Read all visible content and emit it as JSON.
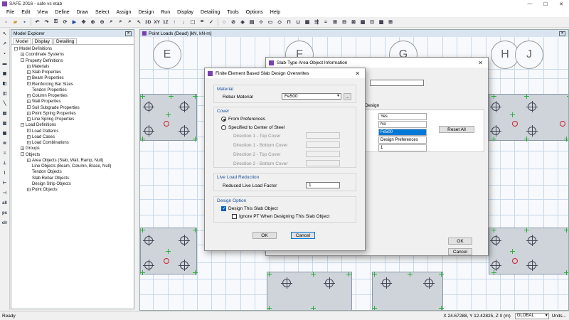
{
  "window": {
    "title": "SAFE 2016 - safe vs etab",
    "controls": [
      "—",
      "☐",
      "✕"
    ]
  },
  "menu": [
    "File",
    "Edit",
    "View",
    "Define",
    "Draw",
    "Select",
    "Assign",
    "Design",
    "Run",
    "Display",
    "Detailing",
    "Tools",
    "Options",
    "Help"
  ],
  "toolbar": {
    "btn_3d": "3D",
    "btn_xy": "XY",
    "btn_1z": "1Z"
  },
  "left_tools": [
    "all",
    "ps",
    "clr"
  ],
  "explorer": {
    "title": "Model Explorer",
    "tabs": [
      "Model",
      "Display",
      "Detailing"
    ],
    "tree": [
      {
        "label": "Model Definitions",
        "level": 0,
        "expander": "-"
      },
      {
        "label": "Coordinate Systems",
        "level": 1,
        "expander": "+"
      },
      {
        "label": "Property Definitions",
        "level": 1,
        "expander": "-"
      },
      {
        "label": "Materials",
        "level": 2,
        "expander": "+"
      },
      {
        "label": "Slab Properties",
        "level": 2,
        "expander": "+"
      },
      {
        "label": "Beam Properties",
        "level": 2,
        "expander": "+"
      },
      {
        "label": "Reinforcing Bar Sizes",
        "level": 2,
        "expander": "+"
      },
      {
        "label": "Tendon Properties",
        "level": 2,
        "expander": ""
      },
      {
        "label": "Column Properties",
        "level": 2,
        "expander": "+"
      },
      {
        "label": "Wall Properties",
        "level": 2,
        "expander": "+"
      },
      {
        "label": "Soil Subgrade Properties",
        "level": 2,
        "expander": "+"
      },
      {
        "label": "Point Spring Properties",
        "level": 2,
        "expander": "+"
      },
      {
        "label": "Line Spring Properties",
        "level": 2,
        "expander": "+"
      },
      {
        "label": "Load Definitions",
        "level": 1,
        "expander": "-"
      },
      {
        "label": "Load Patterns",
        "level": 2,
        "expander": "+"
      },
      {
        "label": "Load Cases",
        "level": 2,
        "expander": "+"
      },
      {
        "label": "Load Combinations",
        "level": 2,
        "expander": "+"
      },
      {
        "label": "Groups",
        "level": 1,
        "expander": "+"
      },
      {
        "label": "Objects",
        "level": 1,
        "expander": "-"
      },
      {
        "label": "Area Objects (Slab, Wall, Ramp, Null)",
        "level": 2,
        "expander": "+"
      },
      {
        "label": "Line Objects (Beam, Column, Brace, Null)",
        "level": 2,
        "expander": ""
      },
      {
        "label": "Tendon Objects",
        "level": 2,
        "expander": ""
      },
      {
        "label": "Slab Rebar Objects",
        "level": 2,
        "expander": ""
      },
      {
        "label": "Design Strip Objects",
        "level": 2,
        "expander": ""
      },
      {
        "label": "Point Objects",
        "level": 2,
        "expander": "+"
      }
    ]
  },
  "canvas": {
    "title": "Point Loads (Dead)  [kN, kN-m]",
    "grid_bubbles": [
      "E",
      "F",
      "G",
      "H",
      "J"
    ]
  },
  "back_dialog": {
    "title": "Slab-Type Area Object Information",
    "tab_label": "Design",
    "table_values": [
      "Yes",
      "No",
      "Fe500",
      "Design Preferences",
      "1"
    ],
    "reset_label": "Reset All",
    "ok_label": "OK",
    "cancel_label": "Cancel"
  },
  "dialog": {
    "title": "Finite Element Based Slab Design Overwrites",
    "close": "✕",
    "material": {
      "group": "Material",
      "label": "Rebar Material",
      "value": "Fe500",
      "browse": "..."
    },
    "cover": {
      "group": "Cover",
      "option1": "From Preferences",
      "option2": "Specified to Center of Steel",
      "dir1_top": "Direction 1  -  Top Cover",
      "dir1_bottom": "Direction 1  -  Bottom Cover",
      "dir2_top": "Direction 2  -  Top Cover",
      "dir2_bottom": "Direction 2  -  Bottom Cover"
    },
    "live_load": {
      "group": "Live Load Reduction",
      "label": "Reduced Live Load Factor",
      "value": "1"
    },
    "design_option": {
      "group": "Design Option",
      "check1": "Design This Slab Object",
      "check2": "Ignore PT When Designing This Slab Object"
    },
    "ok": "OK",
    "cancel": "Cancel"
  },
  "status": {
    "ready": "Ready",
    "coords": "X 24.67288,  Y 12.42825,  Z 0  (m)",
    "coord_system": "GLOBAL",
    "units": "Units..."
  }
}
